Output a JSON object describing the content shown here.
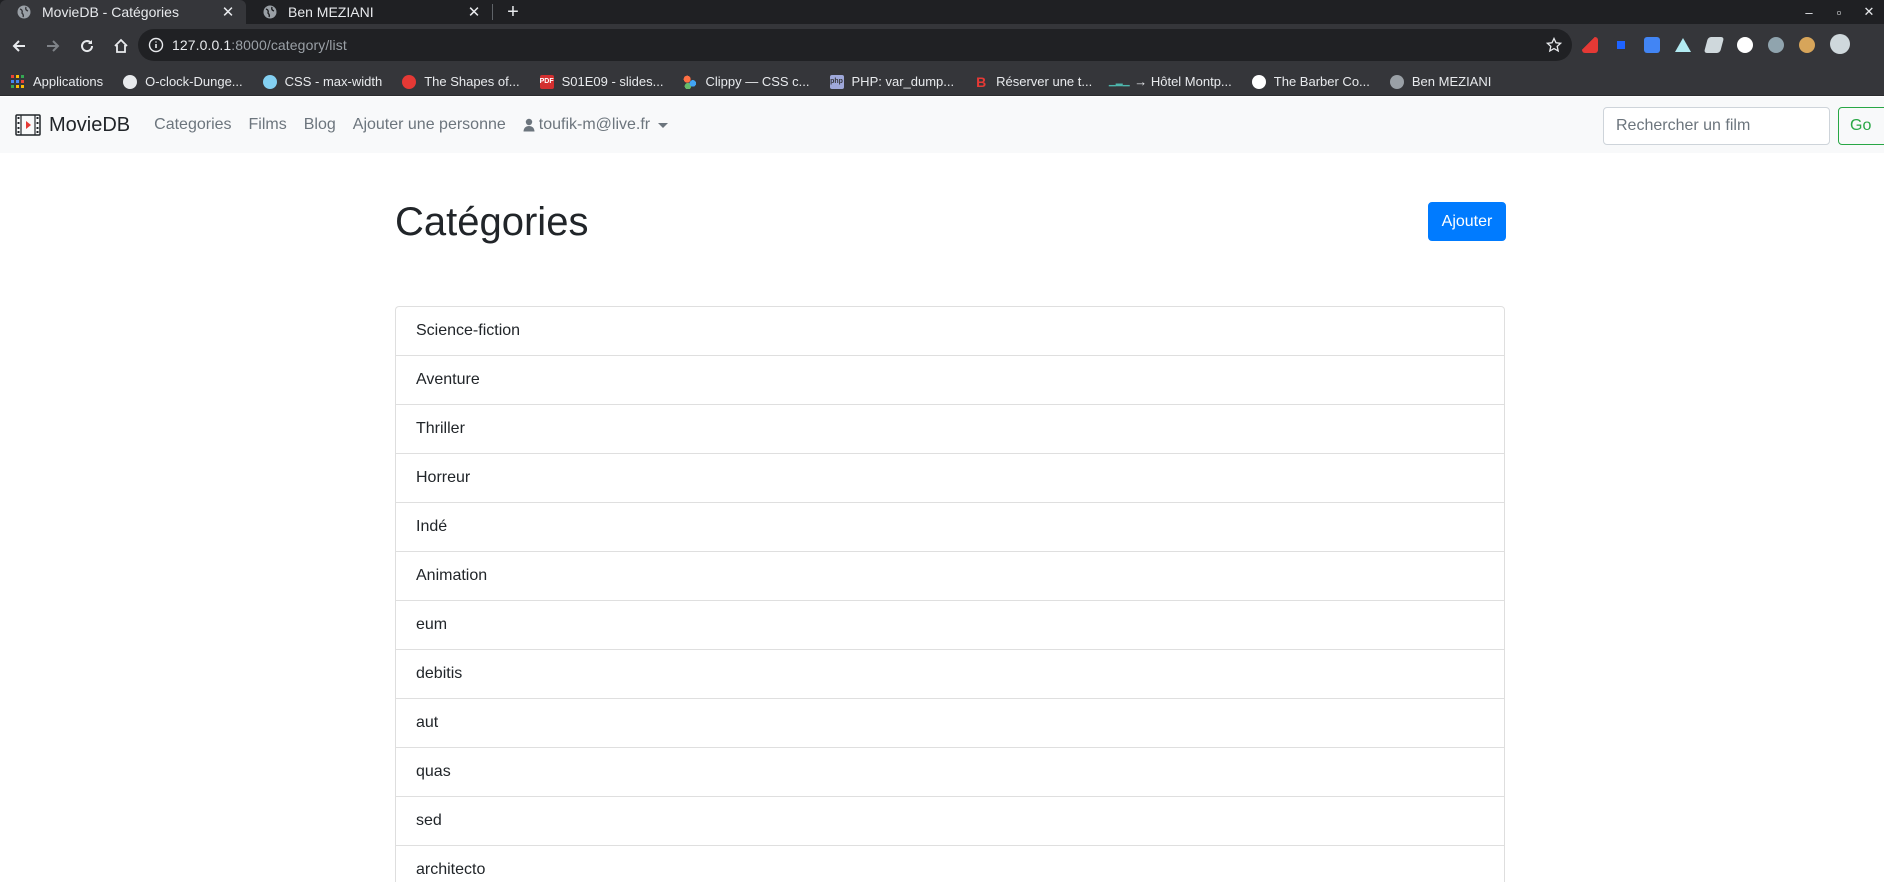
{
  "browser": {
    "tabs": [
      {
        "title": "MovieDB - Catégories",
        "active": true
      },
      {
        "title": "Ben MEZIANI",
        "active": false
      }
    ],
    "new_tab": "+",
    "url_host": "127.0.0.1",
    "url_path": ":8000/category/list",
    "window_controls": {
      "minimize": "–",
      "maximize": "▫",
      "close": "✕"
    }
  },
  "bookmarks": [
    {
      "label": "Applications",
      "icon": "apps-grid-icon"
    },
    {
      "label": "O-clock-Dunge...",
      "icon": "github-icon"
    },
    {
      "label": "CSS - max-width",
      "icon": "mdn-icon"
    },
    {
      "label": "The Shapes of...",
      "icon": "shapes-icon"
    },
    {
      "label": "S01E09 - slides...",
      "icon": "pdf-icon"
    },
    {
      "label": "Clippy — CSS c...",
      "icon": "clippy-icon"
    },
    {
      "label": "PHP: var_dump...",
      "icon": "php-icon"
    },
    {
      "label": "Réserver une t...",
      "icon": "b-icon"
    },
    {
      "label": "→ Hôtel Montp...",
      "icon": "hotel-icon"
    },
    {
      "label": "The Barber Co...",
      "icon": "barber-icon"
    },
    {
      "label": "Ben MEZIANI",
      "icon": "globe-icon"
    }
  ],
  "navbar": {
    "brand": "MovieDB",
    "links": [
      "Categories",
      "Films",
      "Blog",
      "Ajouter une personne"
    ],
    "user": "toufik-m@live.fr",
    "search_placeholder": "Rechercher un film",
    "search_button": "Go"
  },
  "page": {
    "title": "Catégories",
    "add_button": "Ajouter",
    "categories": [
      "Science-fiction",
      "Aventure",
      "Thriller",
      "Horreur",
      "Indé",
      "Animation",
      "eum",
      "debitis",
      "aut",
      "quas",
      "sed",
      "architecto"
    ]
  },
  "colors": {
    "primary": "#007bff",
    "success": "#28a745",
    "navbar_bg": "#f8f9fa",
    "chrome_dark": "#35363a"
  }
}
